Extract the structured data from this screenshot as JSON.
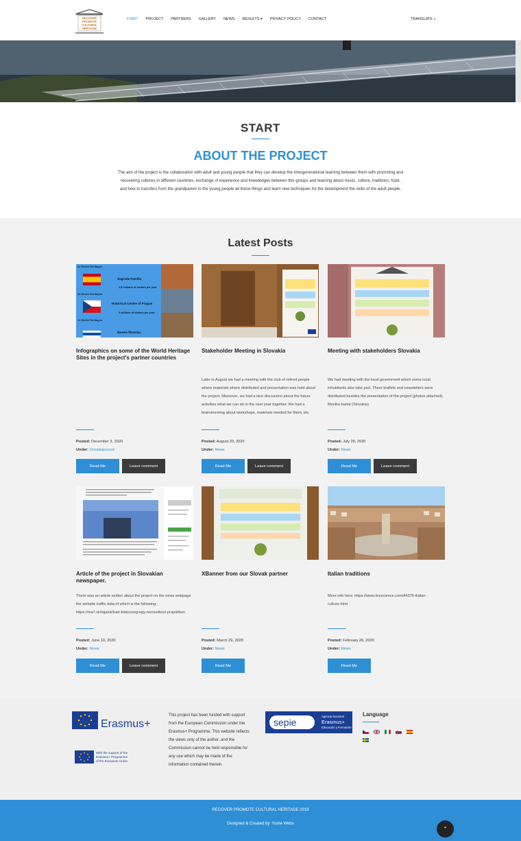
{
  "nav": {
    "items": [
      "START",
      "PROJECT",
      "PARTNERS",
      "GALLERY",
      "NEWS",
      "RESULTS ▾",
      "PRIVACY POLICY",
      "CONTACT"
    ],
    "translate": "TRANSLATE »",
    "logo_text": [
      "RECOVER",
      "PROMOTE",
      "CULTURAL",
      "HERITAGE"
    ]
  },
  "start": {
    "title": "START",
    "about_title": "ABOUT THE PROJECT",
    "about_text": "The aim of the project is the collaboration with adult and young people that they can develop the intergenerational learning between them with promoting and recovering cultures in different countries, exchange of experience and knowledges between this groups and learning about music, culture, traditions, food, and how to transfers from the grandparent to the young people all these things and learn new techniques for the development the skills of the adult people."
  },
  "posts": {
    "title": "Latest Posts",
    "read_more": "Read Me",
    "leave_comment": "Leave comment",
    "posted_label": "Posted:",
    "under_label": "Under:",
    "items": [
      {
        "title": "Infographics on some of the World Heritage Sites in the project's partner countries",
        "excerpt": "",
        "date": "December 3, 2020",
        "category": "Uncategorized",
        "image": [
          "34 World Heritages",
          "Sagrada Familia",
          "4,5 millions of visitors per year",
          "48 World Heritages",
          "Historical Centre of Prague",
          "8 millions of visitors per year",
          "14 World Heritages",
          "Banská Štiavnica"
        ]
      },
      {
        "title": "Stakeholder Meeting in Slovakia",
        "excerpt": "Later in August we had a meeting with the club of retired people where materials where distributed and presentation was held about the project. Moreover, we had a nice discussion about the future activities what we can do in the next year together. We had a brainstorming about workshops, materials needed for them, etc.",
        "date": "August 20, 2020",
        "category": "News"
      },
      {
        "title": "Meeting with stakeholders Slovakia",
        "excerpt": "We had meeting with the local government which some local inhabitants also take part. There leaflets and newsletters were distributed besides the presentation of the project (photos attached).  Monika bartal (Slovakia)",
        "date": "July 26, 2020",
        "category": "News"
      },
      {
        "title": "Article of the project in Slovakian newspaper.",
        "excerpt": "There was an article written about the project on the news webpage the website traffic data of which is the following: https://ma7.sk/tajaink/bart-kiskozseg-egy-nemzetkozi-projektben",
        "date": "June 10, 2020",
        "category": "News"
      },
      {
        "title": "XBanner from our Slovak partner",
        "excerpt": "",
        "date": "March 29, 2020",
        "category": "News"
      },
      {
        "title": "Italian traditions",
        "excerpt": "More info here: https://www.livescience.com/44376-italian-culture.html",
        "date": "February 26, 2020",
        "category": "News"
      }
    ]
  },
  "footer": {
    "erasmus": "Erasmus+",
    "eu_support": [
      "With the support of the",
      "Erasmus+ Programme",
      "of the European Union"
    ],
    "disclaimer": "This project has been funded with support from the European Commission under the Erasmus+ Programme. This website reflects the views only of the author, and the Commission cannot be held responsible for any use which may be made of the information contained therein.",
    "sepie": "sepie",
    "sepie_sub": [
      "Agencia Nacional",
      "Erasmus+",
      "Educación y Formación"
    ],
    "language_title": "Language",
    "copyright": "RECOVER PROMOTE CULTURAL HERITAGE 2019",
    "credits": "Designed & Created by: Yume Webs",
    "to_top": "⌃"
  },
  "colors": {
    "accent": "#2e8fd6",
    "dark_button": "#3a3a3a"
  }
}
